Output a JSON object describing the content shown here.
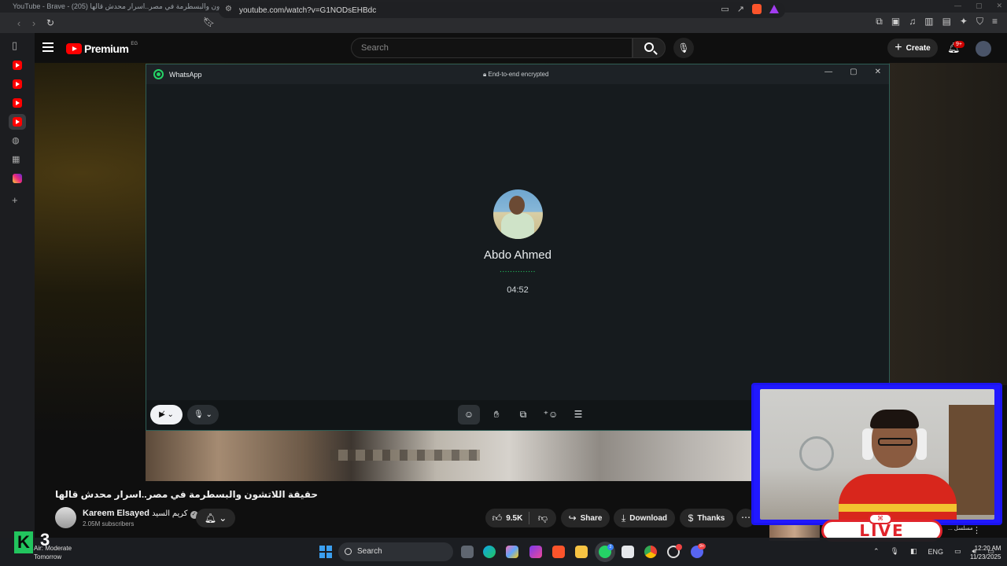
{
  "browser": {
    "window_title": "YouTube - Brave - حقيقة اللاتشون والبسطرمة في مصر..اسرار محدش قالها (205)",
    "url": "youtube.com/watch?v=G1NODsEHBdc"
  },
  "youtube": {
    "logo_text": "Premium",
    "country_code": "EG",
    "search_placeholder": "Search",
    "create_label": "Create",
    "notification_count": "9+",
    "video_title": "حقيقة اللاتشون والبسطرمة في مصر..اسرار محدش قالها",
    "channel_name": "Kareem Elsayed",
    "channel_name_ar": "كريم السيد",
    "subscribers": "2.05M subscribers",
    "like_count": "9.5K",
    "share_label": "Share",
    "download_label": "Download",
    "thanks_label": "Thanks",
    "recommended_title_fragment": "مسلسل ..."
  },
  "whatsapp": {
    "app_name": "WhatsApp",
    "encryption_label": "End-to-end encrypted",
    "callee_name": "Abdo Ahmed",
    "call_status_dots": "..............",
    "call_timer": "04:52"
  },
  "stream_overlay": {
    "live_label": "LIVE",
    "k3_letter": "K",
    "k3_number": "3"
  },
  "taskbar": {
    "weather_label": "Air: Moderate",
    "weather_sub": "Tomorrow",
    "search_label": "Search",
    "language": "ENG",
    "time": "12:20 AM",
    "date": "11/23/2025",
    "whatsapp_badge": "2",
    "discord_badge": "9+"
  },
  "colors": {
    "youtube_red": "#ff0000",
    "whatsapp_green": "#25d366",
    "whatsapp_border": "#2e5d55",
    "webcam_frame_blue": "#2018ff",
    "live_red": "#e0242c"
  }
}
